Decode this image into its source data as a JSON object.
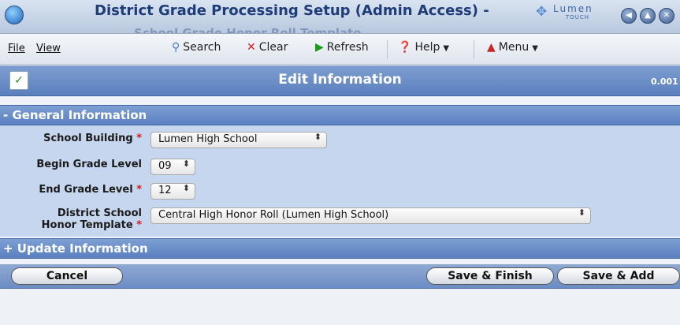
{
  "window": {
    "title": "District Grade Processing Setup (Admin Access) -",
    "subtitle": "School Grade Honor Roll Template",
    "brand": "Lumen",
    "brand_sub": "TOUCH"
  },
  "menubar": {
    "file": "File",
    "view": "View",
    "search": "Search",
    "clear": "Clear",
    "refresh": "Refresh",
    "help": "Help",
    "menu": "Menu"
  },
  "editbar": {
    "title": "Edit Information",
    "version": "0.001"
  },
  "sections": {
    "general": "- General Information",
    "update": "+ Update Information"
  },
  "form": {
    "school_building": {
      "label": "School Building",
      "value": "Lumen High School"
    },
    "begin_grade": {
      "label": "Begin Grade Level",
      "value": "09"
    },
    "end_grade": {
      "label": "End Grade Level",
      "value": "12"
    },
    "honor_template": {
      "label_line1": "District School",
      "label_line2": "Honor Template",
      "value": "Central High Honor Roll (Lumen High School)"
    },
    "required_mark": "*"
  },
  "buttons": {
    "cancel": "Cancel",
    "save_finish": "Save & Finish",
    "save_add": "Save & Add"
  }
}
